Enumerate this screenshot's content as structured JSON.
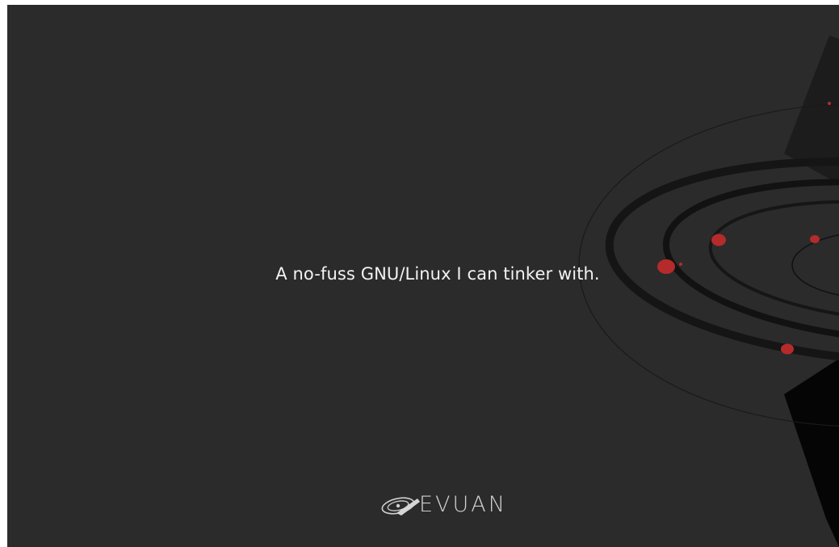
{
  "slide": {
    "tagline": "A no-fuss GNU/Linux I can tinker with.",
    "brand_wordmark": "EVUAN"
  },
  "colors": {
    "background": "#2b2b2b",
    "text": "#f2f2f2",
    "accent": "#b52b2b"
  }
}
